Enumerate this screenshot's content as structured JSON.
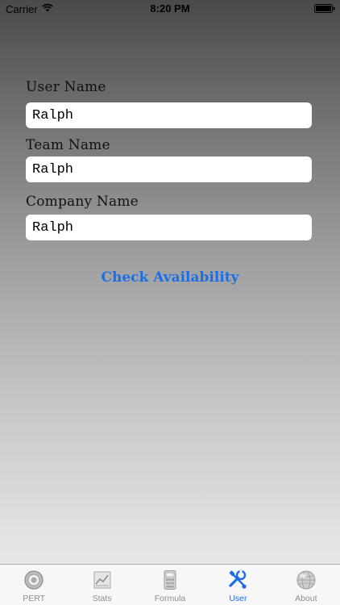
{
  "status_bar": {
    "carrier": "Carrier",
    "time": "8:20 PM"
  },
  "form": {
    "user_name_label": "User Name",
    "user_name_value": "Ralph",
    "team_name_label": "Team Name",
    "team_name_value": "Ralph",
    "company_name_label": "Company Name",
    "company_name_value": "Ralph",
    "check_button_label": "Check Availability"
  },
  "tab_bar": {
    "tabs": [
      {
        "label": "PERT",
        "icon": "pert-icon"
      },
      {
        "label": "Stats",
        "icon": "stats-chart-icon"
      },
      {
        "label": "Formula",
        "icon": "formula-calculator-icon"
      },
      {
        "label": "User",
        "icon": "user-tools-icon",
        "active": true
      },
      {
        "label": "About",
        "icon": "about-globe-icon"
      }
    ]
  },
  "colors": {
    "accent": "#1a6fe8",
    "tab_inactive": "#8e8e8e"
  }
}
